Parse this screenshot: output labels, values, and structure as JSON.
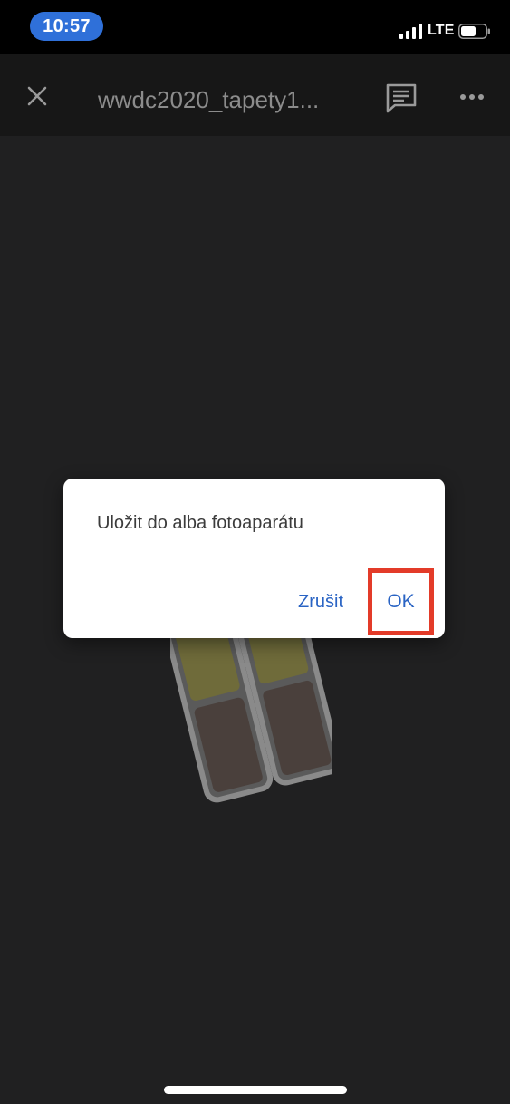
{
  "status_bar": {
    "time": "10:57",
    "network": "LTE",
    "signal_icon": "cellular-signal-icon",
    "battery_icon": "battery-icon"
  },
  "toolbar": {
    "close_icon": "close-icon",
    "title": "wwdc2020_tapety1...",
    "comment_icon": "comment-icon",
    "more_icon": "more-options-icon"
  },
  "content": {
    "placeholder_icon": "image-placeholder-icon"
  },
  "dialog": {
    "message": "Uložit do alba fotoaparátu",
    "cancel_label": "Zrušit",
    "ok_label": "OK"
  },
  "colors": {
    "accent": "#2a64c4",
    "highlight": "#e33b29",
    "time_pill": "#2f70d9"
  }
}
